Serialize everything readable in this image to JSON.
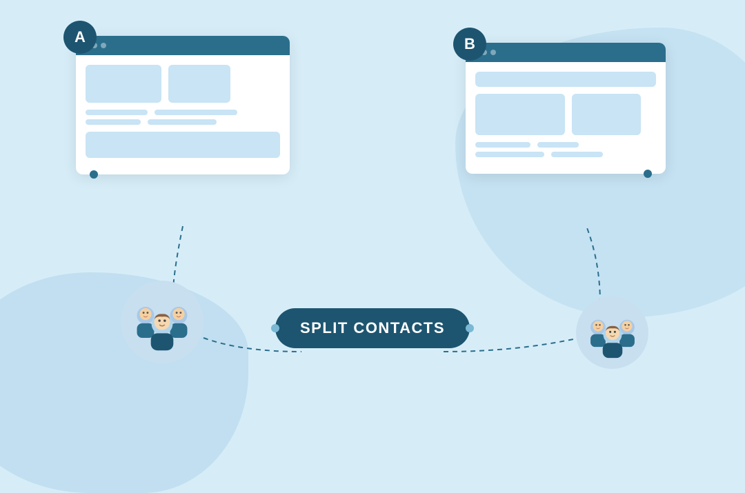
{
  "title": "Split Contacts",
  "badge_a": "A",
  "badge_b": "B",
  "split_contacts_label": "SPLIT CONTACTS",
  "colors": {
    "dark_blue": "#1d5570",
    "mid_blue": "#2a6e8c",
    "light_blue": "#c8e4f5",
    "bg": "#d6edf8",
    "blob": "#b8d9ed",
    "white": "#ffffff",
    "connector_dot": "#7ab8d4"
  }
}
